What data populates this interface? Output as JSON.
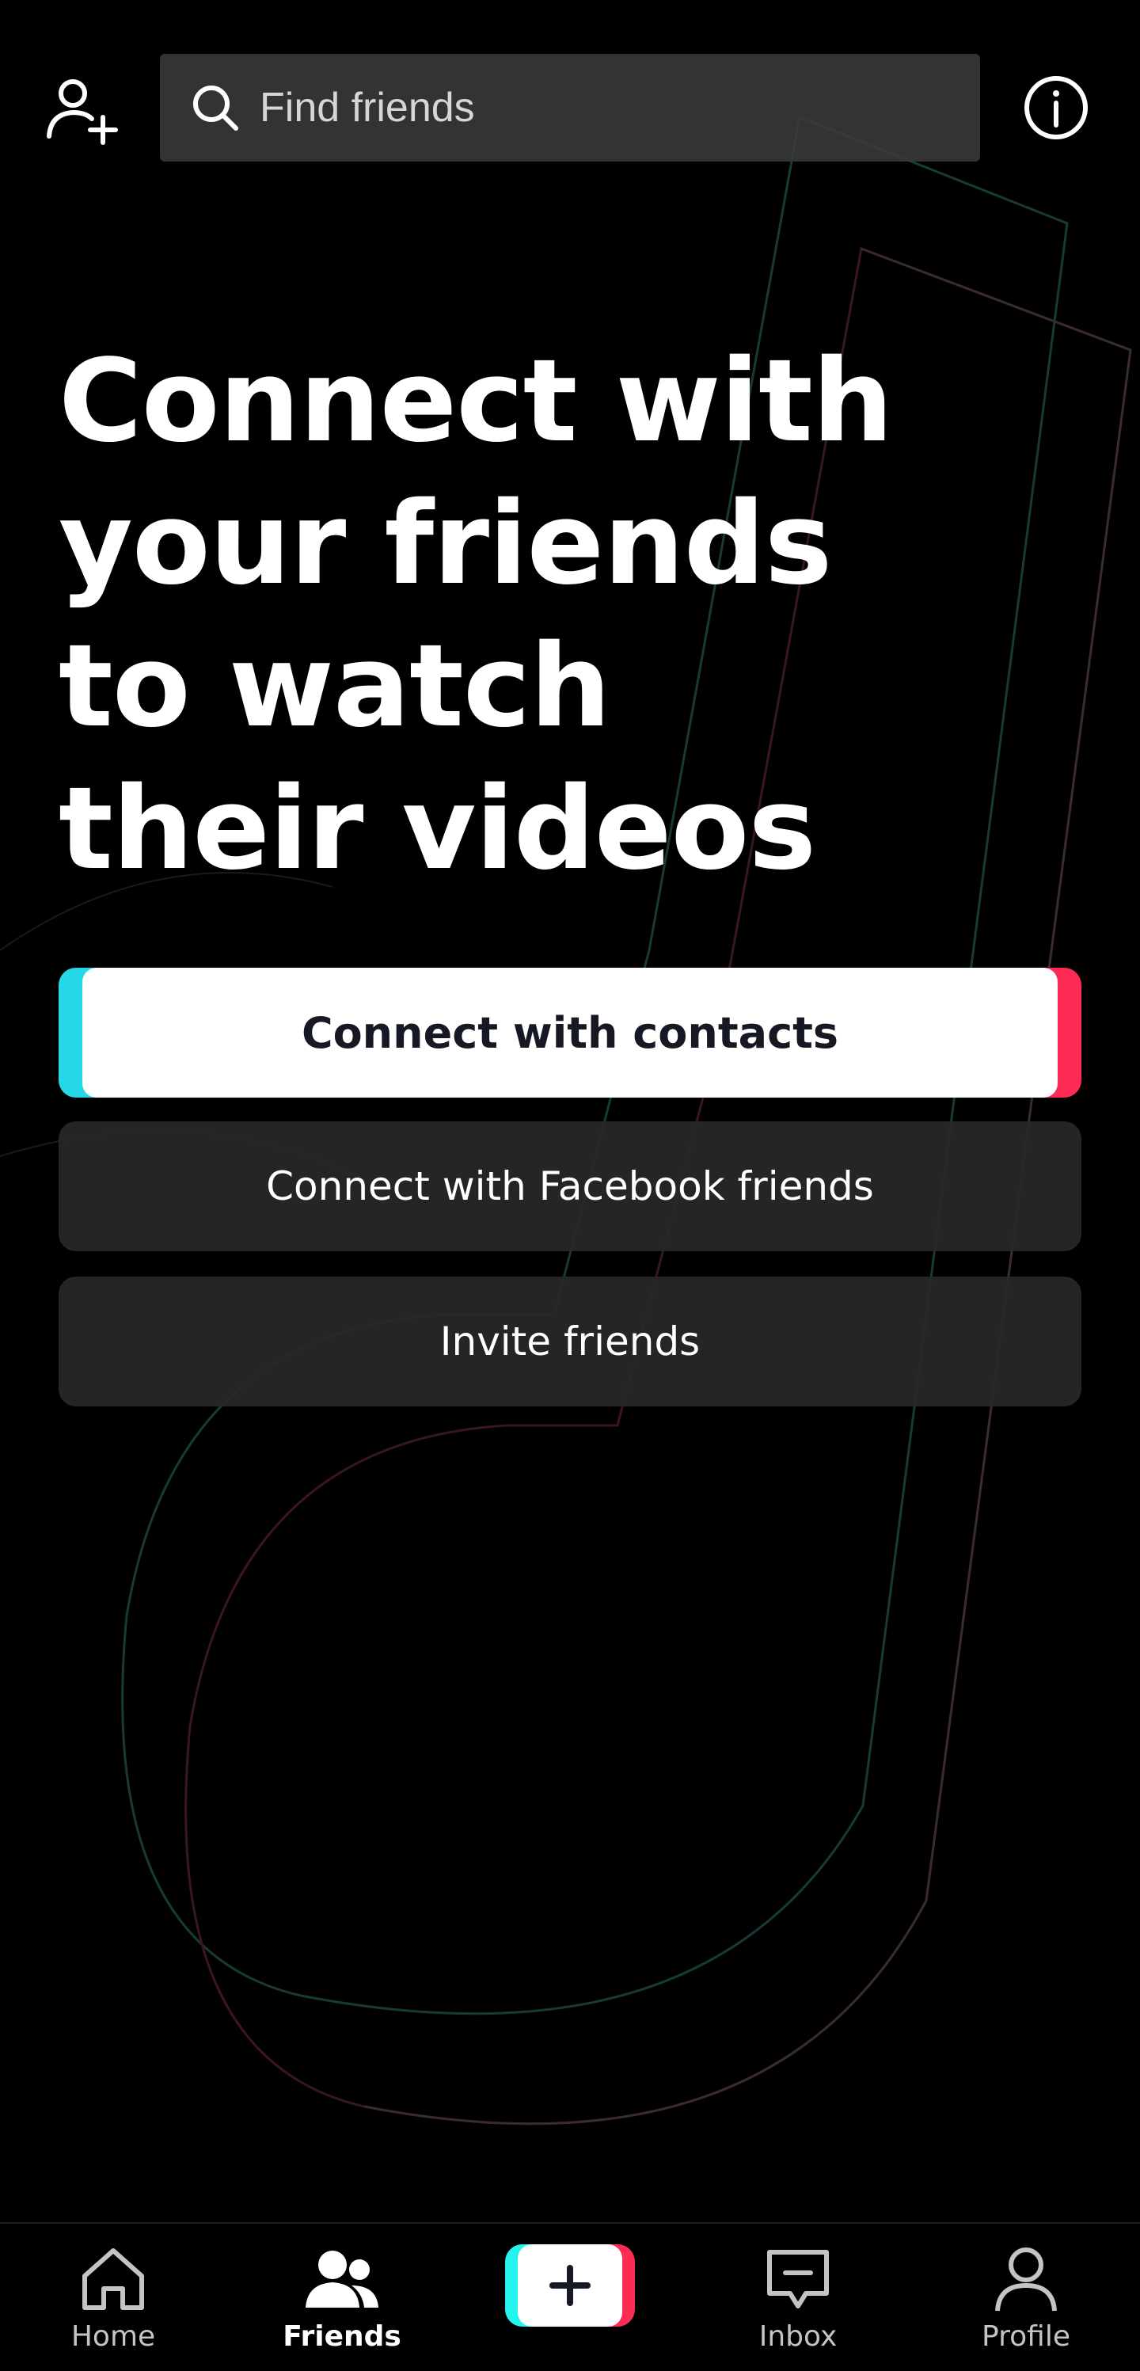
{
  "header": {
    "search_placeholder": "Find friends",
    "add_friend_icon": "add-user-icon",
    "search_icon": "search-icon",
    "info_icon": "info-icon"
  },
  "hero": {
    "lines": [
      "Connect with",
      "your friends",
      "to watch",
      "their videos"
    ]
  },
  "actions": {
    "contacts": "Connect with contacts",
    "facebook": "Connect with Facebook friends",
    "invite": "Invite friends"
  },
  "nav": {
    "home": "Home",
    "friends": "Friends",
    "inbox": "Inbox",
    "profile": "Profile",
    "active": "Friends"
  },
  "colors": {
    "background": "#000000",
    "accent_cyan": "#25f4ee",
    "accent_red": "#fe2c55",
    "button_dark": "#282828",
    "primary_text_dark": "#161823"
  }
}
